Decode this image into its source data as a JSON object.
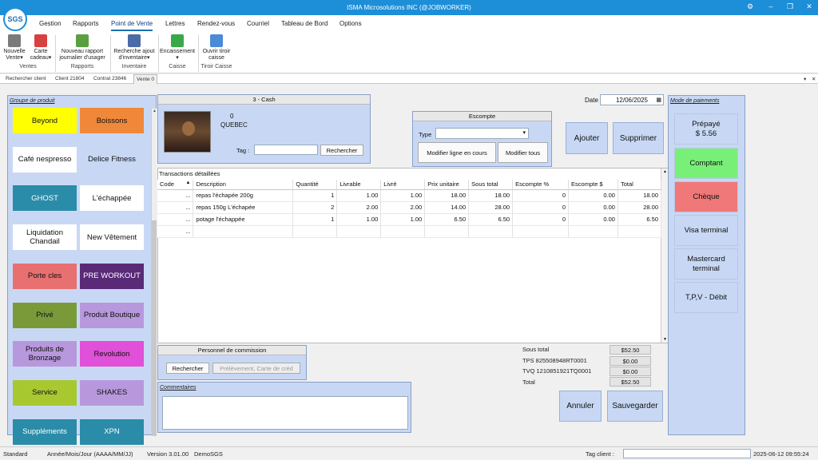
{
  "window": {
    "title": "ISMA Microsolutions INC (@JOBWORKER)",
    "logo_text": "SGS"
  },
  "menu": {
    "items": [
      "Gestion",
      "Rapports",
      "Point de Vente",
      "Lettres",
      "Rendez-vous",
      "Courriel",
      "Tableau de Bord",
      "Options"
    ]
  },
  "ribbon": {
    "nouvelle_vente": "Nouvelle Vente",
    "carte_cadeau": "Carte cadeau",
    "nouveau_rapport": "Nouveau rapport journalier d'usager",
    "recherche_ajout": "Recherche ajout d'inventaire",
    "encaissement": "Encaissement",
    "ouvrir_tiroir": "Ouvrir tiroir caisse",
    "groups": [
      "Ventes",
      "Rapports",
      "Inventaire",
      "Caisse",
      "Tiroir Caisse"
    ]
  },
  "tabs": [
    "Rechercher client",
    "Client 21804",
    "Contrat 23846",
    "Vente 0"
  ],
  "product_groups": {
    "label": "Groupe de produit",
    "items": [
      {
        "label": "Beyond",
        "color": "#ffff00"
      },
      {
        "label": "Boissons",
        "color": "#f0883a"
      },
      {
        "label": "Café nespresso",
        "color": "#ffffff"
      },
      {
        "label": "Delice Fitness",
        "color": "#c8d8f4"
      },
      {
        "label": "GHOST",
        "color": "#2a8ca8"
      },
      {
        "label": "L'échappée",
        "color": "#ffffff"
      },
      {
        "label": "Liquidation Chandail",
        "color": "#ffffff"
      },
      {
        "label": "New Vêtement",
        "color": "#ffffff"
      },
      {
        "label": "Porte cles",
        "color": "#e87070"
      },
      {
        "label": "PRE WORKOUT",
        "color": "#5a2a78"
      },
      {
        "label": "Privé",
        "color": "#7a9a3a"
      },
      {
        "label": "Produit Boutique",
        "color": "#b898dc"
      },
      {
        "label": "Produits de Bronzage",
        "color": "#b898dc"
      },
      {
        "label": "Revolution",
        "color": "#e050d8"
      },
      {
        "label": "Service",
        "color": "#a8c830"
      },
      {
        "label": "SHAKES",
        "color": "#b898dc"
      },
      {
        "label": "Suppléments",
        "color": "#2a8ca8"
      },
      {
        "label": "XPN",
        "color": "#2a8ca8"
      }
    ]
  },
  "client": {
    "header": "3 - Cash",
    "number": "0",
    "province": "QUEBEC",
    "tag_label": "Tag :",
    "tag_value": "",
    "search_button": "Rechercher"
  },
  "escompte": {
    "header": "Escompte",
    "type_label": "Type",
    "type_value": "",
    "modify_line": "Modifier ligne en cours",
    "modify_all": "Modifier tous"
  },
  "date": {
    "label": "Date",
    "value": "12/06/2025"
  },
  "actions": {
    "add": "Ajouter",
    "delete": "Supprimer",
    "cancel": "Annuler",
    "save": "Sauvegarder"
  },
  "transactions": {
    "label": "Transactions détaillées",
    "columns": [
      "Code",
      "Description",
      "Quantité",
      "Livrable",
      "Livré",
      "Prix unitaire",
      "Sous total",
      "Escompte %",
      "Escompte $",
      "Total"
    ],
    "rows": [
      {
        "code": "...",
        "description": "repas l'échapée 200g",
        "quantite": "1",
        "livrable": "1.00",
        "livre": "1.00",
        "prix": "18.00",
        "sous_total": "18.00",
        "esc_pct": "0",
        "esc_dol": "0.00",
        "total": "18.00"
      },
      {
        "code": "...",
        "description": "repas 150g L'échapée",
        "quantite": "2",
        "livrable": "2.00",
        "livre": "2.00",
        "prix": "14.00",
        "sous_total": "28.00",
        "esc_pct": "0",
        "esc_dol": "0.00",
        "total": "28.00"
      },
      {
        "code": "...",
        "description": "potage l'échappée",
        "quantite": "1",
        "livrable": "1.00",
        "livre": "1.00",
        "prix": "6.50",
        "sous_total": "6.50",
        "esc_pct": "0",
        "esc_dol": "0.00",
        "total": "6.50"
      },
      {
        "code": "...",
        "description": "",
        "quantite": "",
        "livrable": "",
        "livre": "",
        "prix": "",
        "sous_total": "",
        "esc_pct": "",
        "esc_dol": "",
        "total": ""
      }
    ]
  },
  "commission": {
    "header": "Personnel de commission",
    "search": "Rechercher",
    "deduction": "Prélèvement, Carte de créd"
  },
  "comments": {
    "label": "Commentaires",
    "value": ""
  },
  "totals": {
    "sous_total_label": "Sous total",
    "sous_total": "$52.50",
    "tps_label": "TPS 825508948RT0001",
    "tps": "$0.00",
    "tvq_label": "TVQ 1210851921TQ0001",
    "tvq": "$0.00",
    "total_label": "Total",
    "total": "$52.50"
  },
  "payment": {
    "label": "Mode de paiements",
    "prepaid_label": "Prépayé",
    "prepaid_amount": "$ 5.56",
    "items": [
      {
        "label": "Comptant",
        "color": "#78f078"
      },
      {
        "label": "Chèque",
        "color": "#f07878"
      },
      {
        "label": "Visa terminal",
        "color": "#c8d8f4"
      },
      {
        "label": "Mastercard terminal",
        "color": "#c8d8f4"
      },
      {
        "label": "T,P,V - Débit",
        "color": "#c8d8f4"
      }
    ]
  },
  "status": {
    "mode": "Standard",
    "date_format": "Année/Mois/Jour (AAAA/MM/JJ)",
    "version": "Version 3.01.00",
    "company": "DemoSGS",
    "tag_label": "Tag client :",
    "tag_value": "",
    "datetime": "2025-06-12 09:55:24"
  }
}
